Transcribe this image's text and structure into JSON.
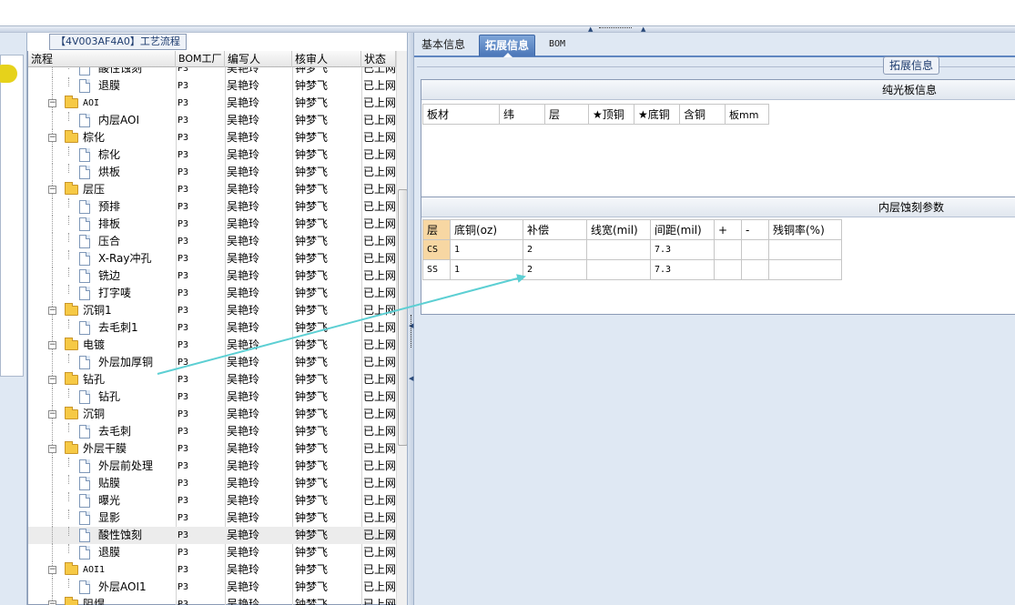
{
  "left_panel": {
    "title": "【4V003AF4A0】工艺流程",
    "columns": [
      "流程",
      "BOM工厂",
      "编写人",
      "核审人",
      "状态"
    ]
  },
  "tree_rows": [
    {
      "indent": 1,
      "type": "doc",
      "label": "酸性蚀刻",
      "bom": "P3",
      "writer": "吴艳玲",
      "reviewer": "钟梦飞",
      "status": "已上网",
      "partial": true
    },
    {
      "indent": 1,
      "type": "doc",
      "label": "退膜",
      "bom": "P3",
      "writer": "吴艳玲",
      "reviewer": "钟梦飞",
      "status": "已上网"
    },
    {
      "indent": 0,
      "type": "folder",
      "label": "AOI",
      "bom": "P3",
      "writer": "吴艳玲",
      "reviewer": "钟梦飞",
      "status": "已上网",
      "mono": true
    },
    {
      "indent": 1,
      "type": "doc",
      "label": "内层AOI",
      "bom": "P3",
      "writer": "吴艳玲",
      "reviewer": "钟梦飞",
      "status": "已上网"
    },
    {
      "indent": 0,
      "type": "folder",
      "label": "棕化",
      "bom": "P3",
      "writer": "吴艳玲",
      "reviewer": "钟梦飞",
      "status": "已上网"
    },
    {
      "indent": 1,
      "type": "doc",
      "label": "棕化",
      "bom": "P3",
      "writer": "吴艳玲",
      "reviewer": "钟梦飞",
      "status": "已上网"
    },
    {
      "indent": 1,
      "type": "doc",
      "label": "烘板",
      "bom": "P3",
      "writer": "吴艳玲",
      "reviewer": "钟梦飞",
      "status": "已上网"
    },
    {
      "indent": 0,
      "type": "folder",
      "label": "层压",
      "bom": "P3",
      "writer": "吴艳玲",
      "reviewer": "钟梦飞",
      "status": "已上网"
    },
    {
      "indent": 1,
      "type": "doc",
      "label": "预排",
      "bom": "P3",
      "writer": "吴艳玲",
      "reviewer": "钟梦飞",
      "status": "已上网"
    },
    {
      "indent": 1,
      "type": "doc",
      "label": "排板",
      "bom": "P3",
      "writer": "吴艳玲",
      "reviewer": "钟梦飞",
      "status": "已上网"
    },
    {
      "indent": 1,
      "type": "doc",
      "label": "压合",
      "bom": "P3",
      "writer": "吴艳玲",
      "reviewer": "钟梦飞",
      "status": "已上网"
    },
    {
      "indent": 1,
      "type": "doc",
      "label": "X-Ray冲孔",
      "bom": "P3",
      "writer": "吴艳玲",
      "reviewer": "钟梦飞",
      "status": "已上网"
    },
    {
      "indent": 1,
      "type": "doc",
      "label": "铣边",
      "bom": "P3",
      "writer": "吴艳玲",
      "reviewer": "钟梦飞",
      "status": "已上网"
    },
    {
      "indent": 1,
      "type": "doc",
      "label": "打字唛",
      "bom": "P3",
      "writer": "吴艳玲",
      "reviewer": "钟梦飞",
      "status": "已上网"
    },
    {
      "indent": 0,
      "type": "folder",
      "label": "沉铜1",
      "bom": "P3",
      "writer": "吴艳玲",
      "reviewer": "钟梦飞",
      "status": "已上网"
    },
    {
      "indent": 1,
      "type": "doc",
      "label": "去毛刺1",
      "bom": "P3",
      "writer": "吴艳玲",
      "reviewer": "钟梦飞",
      "status": "已上网"
    },
    {
      "indent": 0,
      "type": "folder",
      "label": "电镀",
      "bom": "P3",
      "writer": "吴艳玲",
      "reviewer": "钟梦飞",
      "status": "已上网"
    },
    {
      "indent": 1,
      "type": "doc",
      "label": "外层加厚铜",
      "bom": "P3",
      "writer": "吴艳玲",
      "reviewer": "钟梦飞",
      "status": "已上网"
    },
    {
      "indent": 0,
      "type": "folder",
      "label": "钻孔",
      "bom": "P3",
      "writer": "吴艳玲",
      "reviewer": "钟梦飞",
      "status": "已上网"
    },
    {
      "indent": 1,
      "type": "doc",
      "label": "钻孔",
      "bom": "P3",
      "writer": "吴艳玲",
      "reviewer": "钟梦飞",
      "status": "已上网"
    },
    {
      "indent": 0,
      "type": "folder",
      "label": "沉铜",
      "bom": "P3",
      "writer": "吴艳玲",
      "reviewer": "钟梦飞",
      "status": "已上网"
    },
    {
      "indent": 1,
      "type": "doc",
      "label": "去毛刺",
      "bom": "P3",
      "writer": "吴艳玲",
      "reviewer": "钟梦飞",
      "status": "已上网"
    },
    {
      "indent": 0,
      "type": "folder",
      "label": "外层干膜",
      "bom": "P3",
      "writer": "吴艳玲",
      "reviewer": "钟梦飞",
      "status": "已上网"
    },
    {
      "indent": 1,
      "type": "doc",
      "label": "外层前处理",
      "bom": "P3",
      "writer": "吴艳玲",
      "reviewer": "钟梦飞",
      "status": "已上网"
    },
    {
      "indent": 1,
      "type": "doc",
      "label": "贴膜",
      "bom": "P3",
      "writer": "吴艳玲",
      "reviewer": "钟梦飞",
      "status": "已上网"
    },
    {
      "indent": 1,
      "type": "doc",
      "label": "曝光",
      "bom": "P3",
      "writer": "吴艳玲",
      "reviewer": "钟梦飞",
      "status": "已上网"
    },
    {
      "indent": 1,
      "type": "doc",
      "label": "显影",
      "bom": "P3",
      "writer": "吴艳玲",
      "reviewer": "钟梦飞",
      "status": "已上网"
    },
    {
      "indent": 1,
      "type": "doc",
      "label": "酸性蚀刻",
      "bom": "P3",
      "writer": "吴艳玲",
      "reviewer": "钟梦飞",
      "status": "已上网",
      "selected": true
    },
    {
      "indent": 1,
      "type": "doc",
      "label": "退膜",
      "bom": "P3",
      "writer": "吴艳玲",
      "reviewer": "钟梦飞",
      "status": "已上网"
    },
    {
      "indent": 0,
      "type": "folder",
      "label": "AOI1",
      "bom": "P3",
      "writer": "吴艳玲",
      "reviewer": "钟梦飞",
      "status": "已上网",
      "mono": true
    },
    {
      "indent": 1,
      "type": "doc",
      "label": "外层AOI1",
      "bom": "P3",
      "writer": "吴艳玲",
      "reviewer": "钟梦飞",
      "status": "已上网"
    },
    {
      "indent": 0,
      "type": "folder",
      "label": "阻焊",
      "bom": "P3",
      "writer": "吴艳玲",
      "reviewer": "钟梦飞",
      "status": "已上网"
    }
  ],
  "tabs": [
    {
      "label": "基本信息",
      "active": false
    },
    {
      "label": "拓展信息",
      "active": true
    },
    {
      "label": "BOM",
      "active": false
    }
  ],
  "fieldset_legend": "拓展信息",
  "panel1": {
    "title": "纯光板信息",
    "headers": [
      "板材",
      "纬",
      "层",
      "★顶铜",
      "★底铜",
      "含铜",
      "板mm"
    ]
  },
  "panel2": {
    "title": "内层蚀刻参数",
    "headers": [
      "层",
      "底铜(oz)",
      "补偿",
      "线宽(mil)",
      "间距(mil)",
      "+",
      "-",
      "残铜率(%)"
    ],
    "rows": [
      [
        "CS",
        "1",
        "2",
        "",
        "7.3",
        "",
        "",
        ""
      ],
      [
        "SS",
        "1",
        "2",
        "",
        "7.3",
        "",
        "",
        ""
      ]
    ]
  },
  "colors": {
    "accent": "#4a76b8",
    "highlight": "#f7d7a3",
    "arrow": "#5ccfd3"
  }
}
